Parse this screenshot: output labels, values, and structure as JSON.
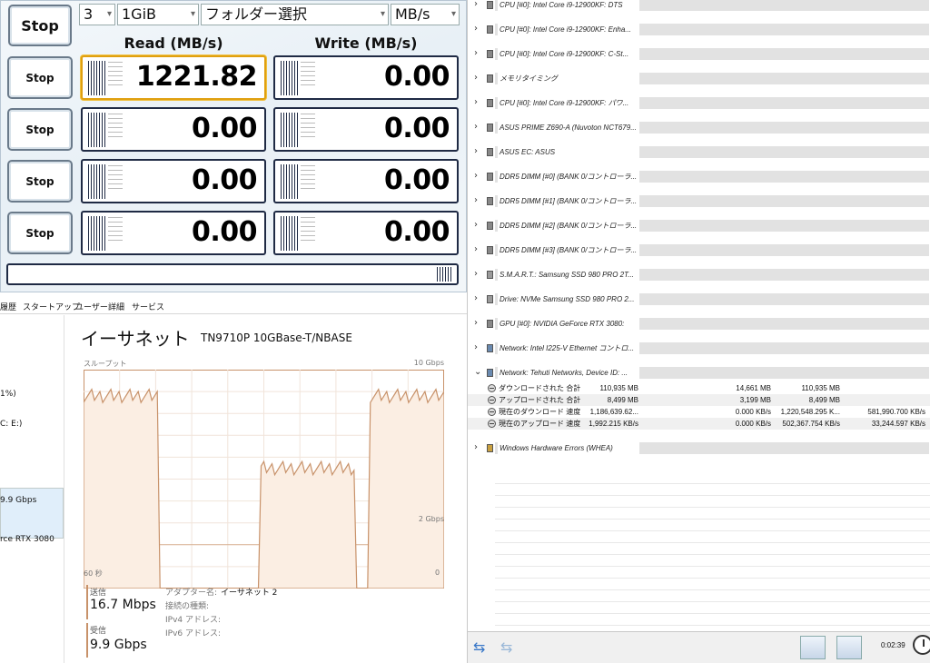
{
  "bench": {
    "stop_all": "Stop",
    "count": "3",
    "size": "1GiB",
    "target": "フォルダー選択",
    "unit": "MB/s",
    "read_header": "Read (MB/s)",
    "write_header": "Write (MB/s)",
    "rows": [
      {
        "stop": "Stop",
        "read": "1221.82",
        "write": "0.00"
      },
      {
        "stop": "Stop",
        "read": "0.00",
        "write": "0.00"
      },
      {
        "stop": "Stop",
        "read": "0.00",
        "write": "0.00"
      },
      {
        "stop": "Stop",
        "read": "0.00",
        "write": "0.00"
      }
    ]
  },
  "taskmgr": {
    "tabs": [
      "履歴",
      "スタートアップ",
      "ユーザー",
      "詳細",
      "サービス"
    ],
    "side": [
      "1%)",
      "C: E:)",
      "9.9 Gbps",
      "rce RTX 3080"
    ],
    "title": "イーサネット",
    "adapter": "TN9710P 10GBase-T/NBASE",
    "throughput_label": "スループット",
    "scale_max": "10 Gbps",
    "scale_mid": "2 Gbps",
    "time_left": "60 秒",
    "time_right": "0",
    "send_label": "送信",
    "send_value": "16.7 Mbps",
    "recv_label": "受信",
    "recv_value": "9.9 Gbps",
    "props": [
      {
        "k": "アダプター名:",
        "v": "イーサネット 2"
      },
      {
        "k": "接続の種類:",
        "v": ""
      },
      {
        "k": "IPv4 アドレス:",
        "v": ""
      },
      {
        "k": "IPv6 アドレス:",
        "v": ""
      }
    ],
    "throughput_percent": [
      88,
      88,
      88,
      88,
      88,
      88,
      88,
      88,
      88,
      88,
      88,
      88,
      88,
      88,
      88,
      88,
      88,
      88,
      88,
      88,
      88,
      88,
      88,
      88,
      88,
      88,
      88,
      88,
      0,
      0,
      0,
      0,
      0,
      0,
      0,
      0,
      0,
      0,
      0,
      0,
      0,
      0,
      0,
      0,
      0,
      0,
      0,
      0,
      0,
      0,
      0,
      0,
      0,
      0,
      0,
      0,
      0,
      0,
      0,
      0,
      0,
      0,
      0,
      0,
      0,
      55,
      55,
      55,
      55,
      55,
      55,
      55,
      55,
      55,
      55,
      55,
      55,
      55,
      55,
      55,
      55,
      55,
      55,
      55,
      55,
      55,
      55,
      55,
      55,
      55,
      55,
      55,
      55,
      55,
      55,
      55,
      55,
      55,
      55,
      55,
      0,
      0,
      0,
      0,
      0,
      88,
      88,
      88,
      88,
      88,
      88,
      88,
      88,
      88,
      88,
      88,
      88,
      88,
      88,
      88,
      88,
      88,
      88,
      88,
      88,
      88,
      88,
      88,
      88,
      88,
      88,
      88,
      88
    ]
  },
  "sensors": {
    "groups": [
      {
        "icon": "cpu",
        "label": "CPU [#0]: Intel Core i9-12900KF: DTS"
      },
      {
        "icon": "cpu",
        "label": "CPU [#0]: Intel Core i9-12900KF: Enha..."
      },
      {
        "icon": "cpu",
        "label": "CPU [#0]: Intel Core i9-12900KF: C-St..."
      },
      {
        "icon": "cpu",
        "label": "メモリタイミング"
      },
      {
        "icon": "cpu",
        "label": "CPU [#0]: Intel Core i9-12900KF: パワ..."
      },
      {
        "icon": "cpu",
        "label": "ASUS PRIME Z690-A (Nuvoton NCT679..."
      },
      {
        "icon": "cpu",
        "label": "ASUS EC: ASUS"
      },
      {
        "icon": "cpu",
        "label": "DDR5 DIMM [#0] (BANK 0/コントローラ..."
      },
      {
        "icon": "cpu",
        "label": "DDR5 DIMM [#1] (BANK 0/コントローラ..."
      },
      {
        "icon": "cpu",
        "label": "DDR5 DIMM [#2] (BANK 0/コントローラ..."
      },
      {
        "icon": "cpu",
        "label": "DDR5 DIMM [#3] (BANK 0/コントローラ..."
      },
      {
        "icon": "disk",
        "label": "S.M.A.R.T.: Samsung SSD 980 PRO 2T..."
      },
      {
        "icon": "disk",
        "label": "Drive: NVMe Samsung SSD 980 PRO 2..."
      },
      {
        "icon": "cpu",
        "label": "GPU [#0]: NVIDIA GeForce RTX 3080:"
      },
      {
        "icon": "net",
        "label": "Network: Intel I225-V Ethernet コントロ..."
      },
      {
        "icon": "net",
        "label": "Network: Tehuti Networks, Device ID: ..."
      }
    ],
    "expanded": [
      {
        "name": "ダウンロードされた 合計",
        "v0": "110,935 MB",
        "v1": "14,661 MB",
        "v2": "110,935 MB",
        "v3": ""
      },
      {
        "name": "アップロードされた 合計",
        "v0": "8,499 MB",
        "v1": "3,199 MB",
        "v2": "8,499 MB",
        "v3": ""
      },
      {
        "name": "現在のダウンロード 速度",
        "v0": "1,186,639.62...",
        "v1": "0.000 KB/s",
        "v2": "1,220,548.295 K...",
        "v3": "581,990.700 KB/s"
      },
      {
        "name": "現在のアップロード 速度",
        "v0": "1,992.215 KB/s",
        "v1": "0.000 KB/s",
        "v2": "502,367.754 KB/s",
        "v3": "33,244.597 KB/s"
      }
    ],
    "last_group": {
      "icon": "err",
      "label": "Windows Hardware Errors (WHEA)"
    },
    "timer": "0:02:39"
  }
}
